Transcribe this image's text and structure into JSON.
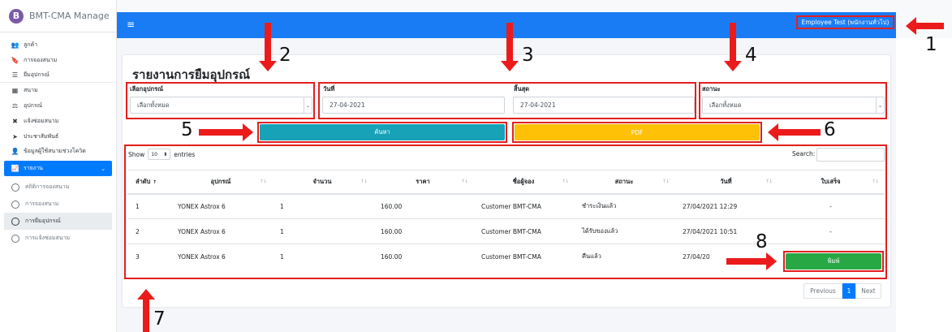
{
  "brand": {
    "logo_letter": "B",
    "name": "BMT-CMA Manage"
  },
  "sidebar": {
    "items": [
      {
        "icon": "users-icon",
        "glyph": "👥",
        "label": "ลูกค้า"
      },
      {
        "icon": "bookmark-icon",
        "glyph": "🔖",
        "label": "การจองสนาม"
      },
      {
        "icon": "list-icon",
        "glyph": "☰",
        "label": "ยืมอุปกรณ์"
      },
      {
        "icon": "table-icon",
        "glyph": "▦",
        "label": "สนาม"
      },
      {
        "icon": "equipment-icon",
        "glyph": "⚖",
        "label": "อุปกรณ์"
      },
      {
        "icon": "tools-icon",
        "glyph": "✖",
        "label": "แจ้งซ่อมสนาม"
      },
      {
        "icon": "megaphone-icon",
        "glyph": "➤",
        "label": "ประชาสัมพันธ์"
      },
      {
        "icon": "user-icon",
        "glyph": "👤",
        "label": "ข้อมูลผู้ใช้สนามช่วงโควิด"
      }
    ],
    "report": {
      "icon": "chart-icon",
      "glyph": "📈",
      "label": "รายงาน",
      "caret": "⌄"
    },
    "report_sub": [
      "สถิติการจองสนาม",
      "การจองสนาม",
      "การยืมอุปกรณ์",
      "การแจ้งซ่อมสนาม"
    ]
  },
  "topbar": {
    "menu_glyph": "≡",
    "user": "Employee Test (พนักงานทั่วไป)"
  },
  "page": {
    "title": "รายงานการยืมอุปกรณ์"
  },
  "filters": {
    "equipment_label": "เลือกอุปกรณ์",
    "equipment_value": "เลือกทั้งหมด",
    "date_label": "วันที่",
    "date_value": "27-04-2021",
    "end_label": "สิ้นสุด",
    "end_value": "27-04-2021",
    "status_label": "สถานะ",
    "status_value": "เลือกทั้งหมด",
    "arrow_glyph": "⌄"
  },
  "buttons": {
    "search": "ค้นหา",
    "pdf": "PDF",
    "print": "พิมพ์"
  },
  "table_controls": {
    "show": "Show",
    "length": "10",
    "length_arrow": "⬍",
    "entries": "entries",
    "search": "Search:"
  },
  "table": {
    "columns": [
      "ลำดับ",
      "อุปกรณ์",
      "จำนวน",
      "ราคา",
      "ชื่อผู้จอง",
      "สถานะ",
      "วันที่",
      "ใบเสร็จ"
    ],
    "first_sort": "↑",
    "sort_glyph": "↑↓",
    "rows": [
      [
        "1",
        "YONEX Astrox 6",
        "1",
        "160.00",
        "Customer BMT-CMA",
        "ชำระเงินแล้ว",
        "27/04/2021 12:29",
        "-"
      ],
      [
        "2",
        "YONEX Astrox 6",
        "1",
        "160.00",
        "Customer BMT-CMA",
        "ได้รับของแล้ว",
        "27/04/2021 10:51",
        "-"
      ],
      [
        "3",
        "YONEX Astrox 6",
        "1",
        "160.00",
        "Customer BMT-CMA",
        "คืนแล้ว",
        "27/04/20",
        ""
      ]
    ]
  },
  "pagination": {
    "previous": "Previous",
    "current": "1",
    "next": "Next"
  },
  "annotations": [
    "1",
    "2",
    "3",
    "4",
    "5",
    "6",
    "7",
    "8"
  ],
  "colors": {
    "topbar": "#1a7cf5",
    "highlight": "#e41e1e",
    "search_button": "#17a2b8",
    "pdf_button": "#ffc107",
    "print_button": "#28a745",
    "active_nav": "#007bff"
  }
}
